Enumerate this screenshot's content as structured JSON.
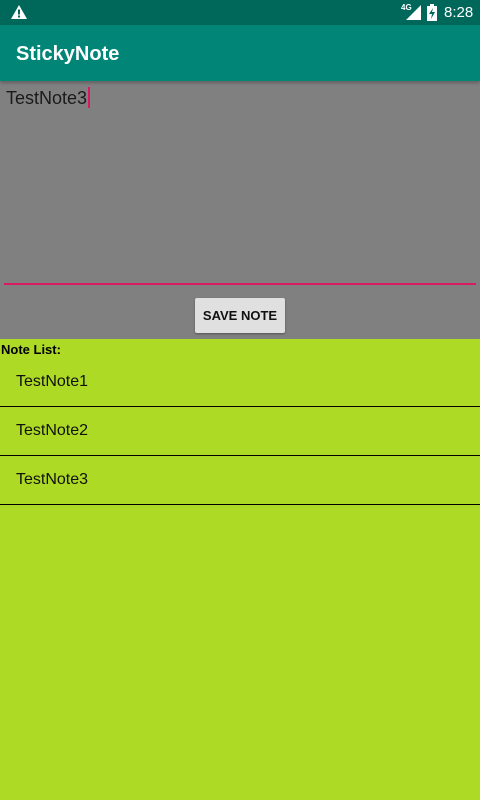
{
  "status_bar": {
    "network_label": "4G",
    "time": "8:28",
    "icons": [
      "warning-icon",
      "signal-icon",
      "battery-charging-icon"
    ]
  },
  "app_bar": {
    "title": "StickyNote"
  },
  "editor": {
    "value": "TestNote3",
    "accent_color": "#D81B60",
    "background": "#808080"
  },
  "save_button": {
    "label": "SAVE NOTE"
  },
  "note_list": {
    "header": "Note List:",
    "background": "#ADDA25",
    "items": [
      {
        "label": "TestNote1"
      },
      {
        "label": "TestNote2"
      },
      {
        "label": "TestNote3"
      }
    ]
  },
  "colors": {
    "status_bar": "#00675B",
    "app_bar": "#008577"
  }
}
